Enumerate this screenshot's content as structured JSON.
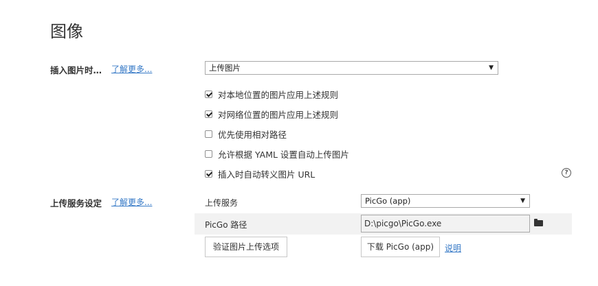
{
  "page": {
    "title": "图像"
  },
  "insert": {
    "label": "插入图片时…",
    "learn_more": "了解更多...",
    "select_value": "上传图片",
    "options": [
      {
        "label": "对本地位置的图片应用上述规则",
        "checked": true
      },
      {
        "label": "对网络位置的图片应用上述规则",
        "checked": true
      },
      {
        "label": "优先使用相对路径",
        "checked": false
      },
      {
        "label": "允许根据 YAML 设置自动上传图片",
        "checked": false
      },
      {
        "label": "插入时自动转义图片 URL",
        "checked": true
      }
    ]
  },
  "upload": {
    "label": "上传服务设定",
    "learn_more": "了解更多...",
    "service_label": "上传服务",
    "service_value": "PicGo (app)",
    "path_label": "PicGo 路径",
    "path_value": "D:\\picgo\\PicGo.exe",
    "verify_button": "验证图片上传选项",
    "download_button": "下载 PicGo (app)",
    "explain_link": "说明"
  },
  "icons": {
    "dropdown": "chevron-down-icon",
    "help": "help-icon",
    "folder": "folder-icon"
  }
}
